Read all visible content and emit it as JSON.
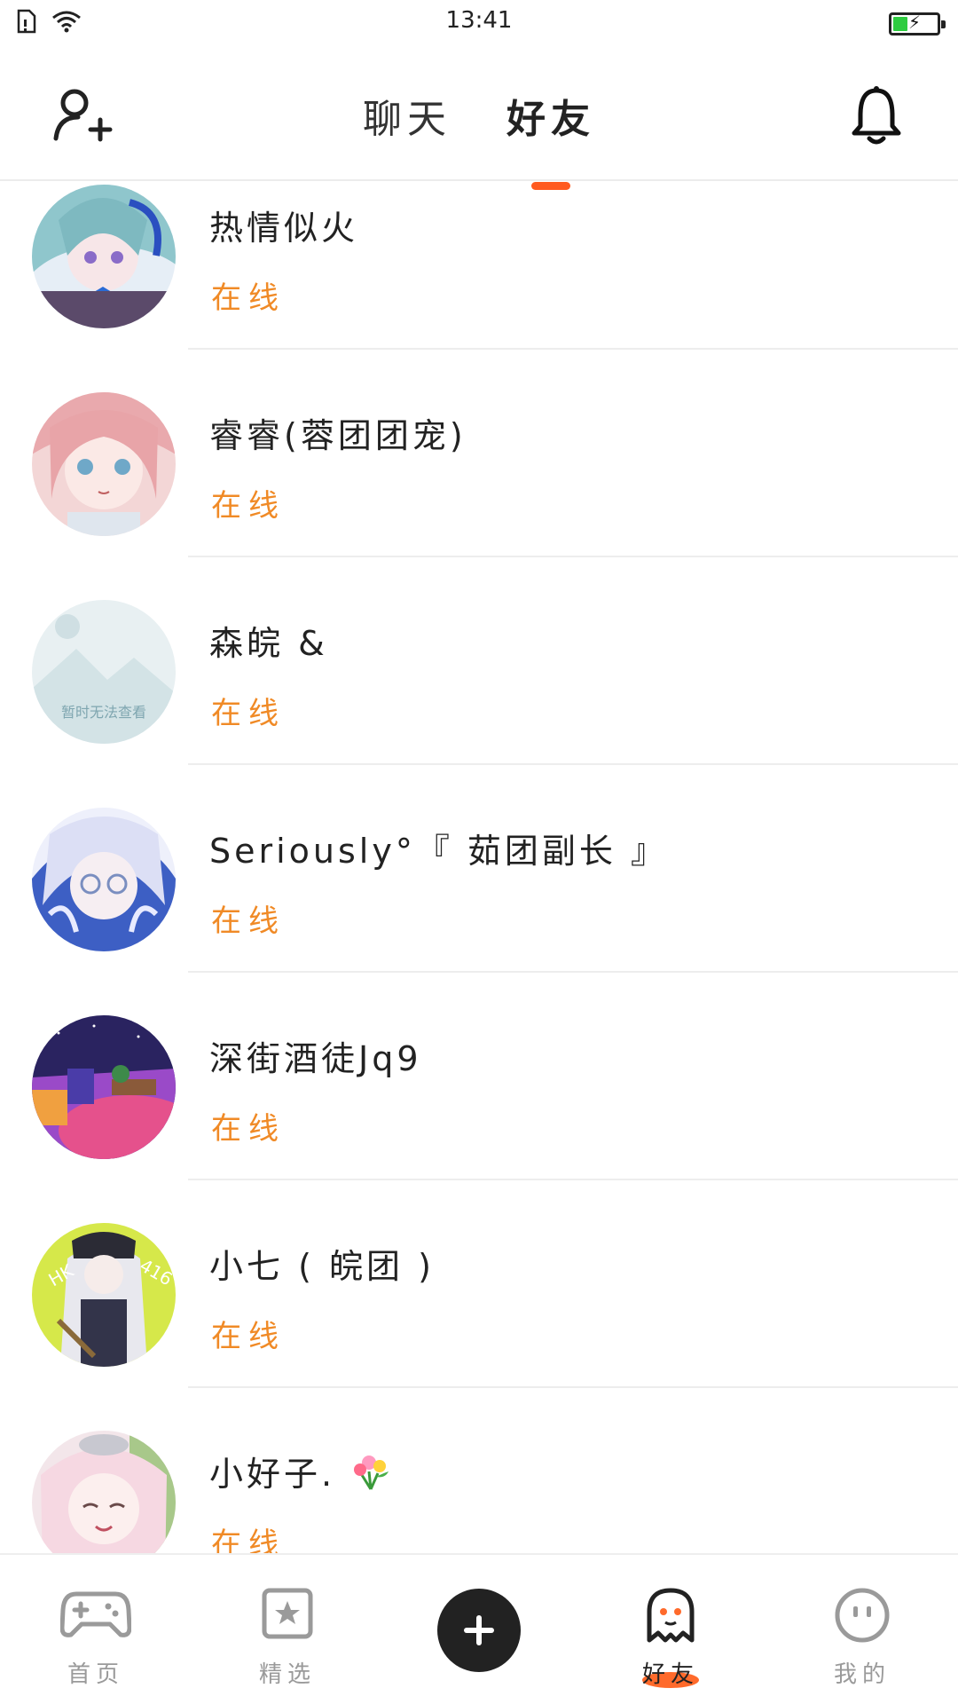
{
  "status_bar": {
    "time": "13:41",
    "battery_level": 0.3
  },
  "header": {
    "tabs": [
      {
        "label": "聊天",
        "active": false
      },
      {
        "label": "好友",
        "active": true
      }
    ],
    "add_friend_icon": "add-user-icon",
    "notification_icon": "bell-icon",
    "accent_color": "#ff5a1f"
  },
  "friends": [
    {
      "name": "热情似火",
      "status": "在线"
    },
    {
      "name": "睿睿(蓉团团宠)",
      "status": "在线"
    },
    {
      "name": "森皖 &",
      "status": "在线",
      "avatar_placeholder_text": "暂时无法查看"
    },
    {
      "name": "Seriously°『 茹团副长 』",
      "status": "在线"
    },
    {
      "name": "深街酒徒Jq9",
      "status": "在线"
    },
    {
      "name": "小七 ( 皖团 )",
      "status": "在线"
    },
    {
      "name": "小好子.",
      "status": "在线"
    }
  ],
  "status_color": "#f08a26",
  "bottom_nav": {
    "items": [
      {
        "label": "首页",
        "icon": "gamepad-icon"
      },
      {
        "label": "精选",
        "icon": "star-bookmark-icon"
      },
      {
        "label": "",
        "icon": "plus-icon"
      },
      {
        "label": "好友",
        "icon": "ghost-icon",
        "active": true
      },
      {
        "label": "我的",
        "icon": "face-icon"
      }
    ]
  }
}
